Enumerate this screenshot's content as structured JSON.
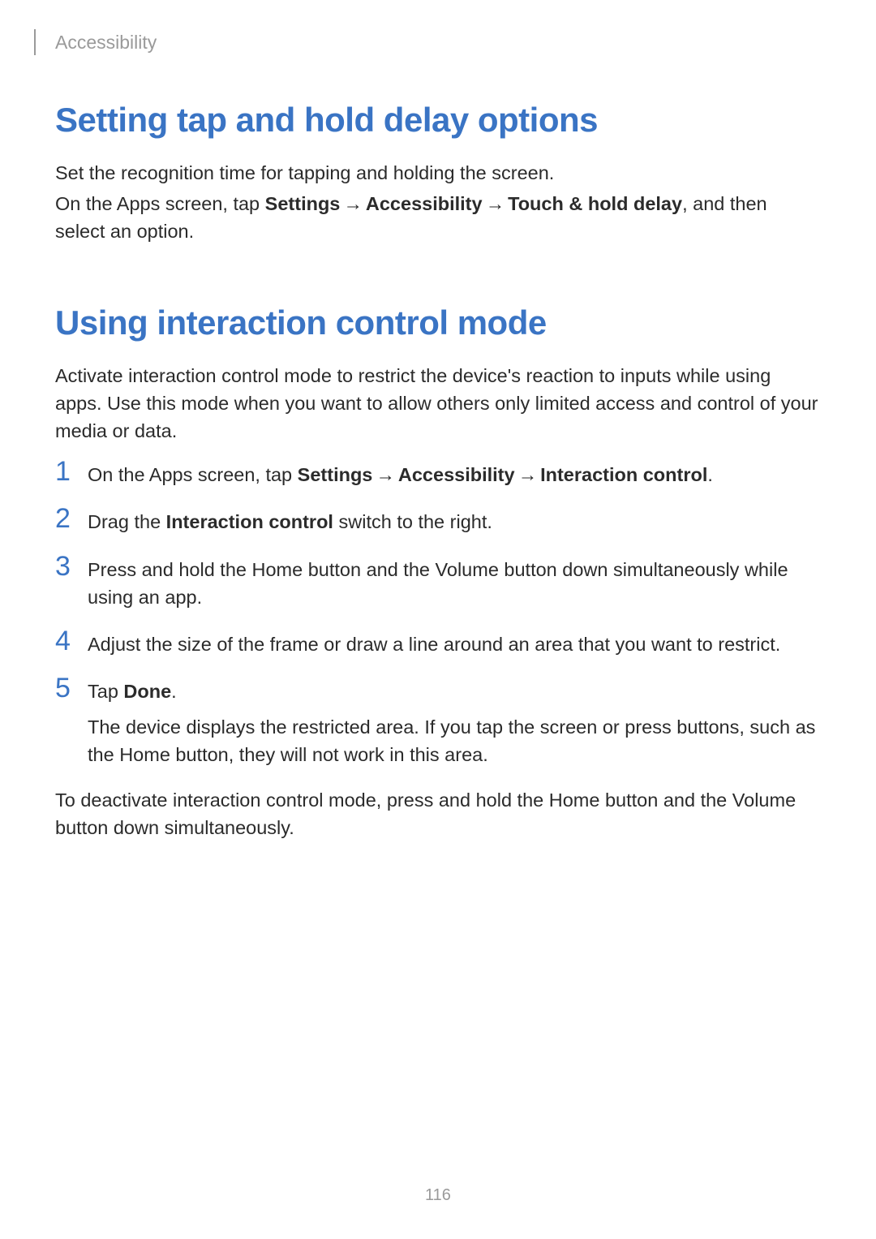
{
  "header": {
    "section": "Accessibility"
  },
  "section1": {
    "title": "Setting tap and hold delay options",
    "p1": "Set the recognition time for tapping and holding the screen.",
    "p2_a": "On the Apps screen, tap ",
    "p2_b1": "Settings",
    "p2_b2": "Accessibility",
    "p2_b3": "Touch & hold delay",
    "p2_c": ", and then select an option."
  },
  "section2": {
    "title": "Using interaction control mode",
    "intro": "Activate interaction control mode to restrict the device's reaction to inputs while using apps. Use this mode when you want to allow others only limited access and control of your media or data.",
    "steps": {
      "n1": "1",
      "s1_a": "On the Apps screen, tap ",
      "s1_b1": "Settings",
      "s1_b2": "Accessibility",
      "s1_b3": "Interaction control",
      "s1_c": ".",
      "n2": "2",
      "s2_a": "Drag the ",
      "s2_b": "Interaction control",
      "s2_c": " switch to the right.",
      "n3": "3",
      "s3": "Press and hold the Home button and the Volume button down simultaneously while using an app.",
      "n4": "4",
      "s4": "Adjust the size of the frame or draw a line around an area that you want to restrict.",
      "n5": "5",
      "s5_a": "Tap ",
      "s5_b": "Done",
      "s5_c": ".",
      "s5_follow": "The device displays the restricted area. If you tap the screen or press buttons, such as the Home button, they will not work in this area."
    },
    "outro": "To deactivate interaction control mode, press and hold the Home button and the Volume button down simultaneously."
  },
  "arrow": "→",
  "page_number": "116"
}
